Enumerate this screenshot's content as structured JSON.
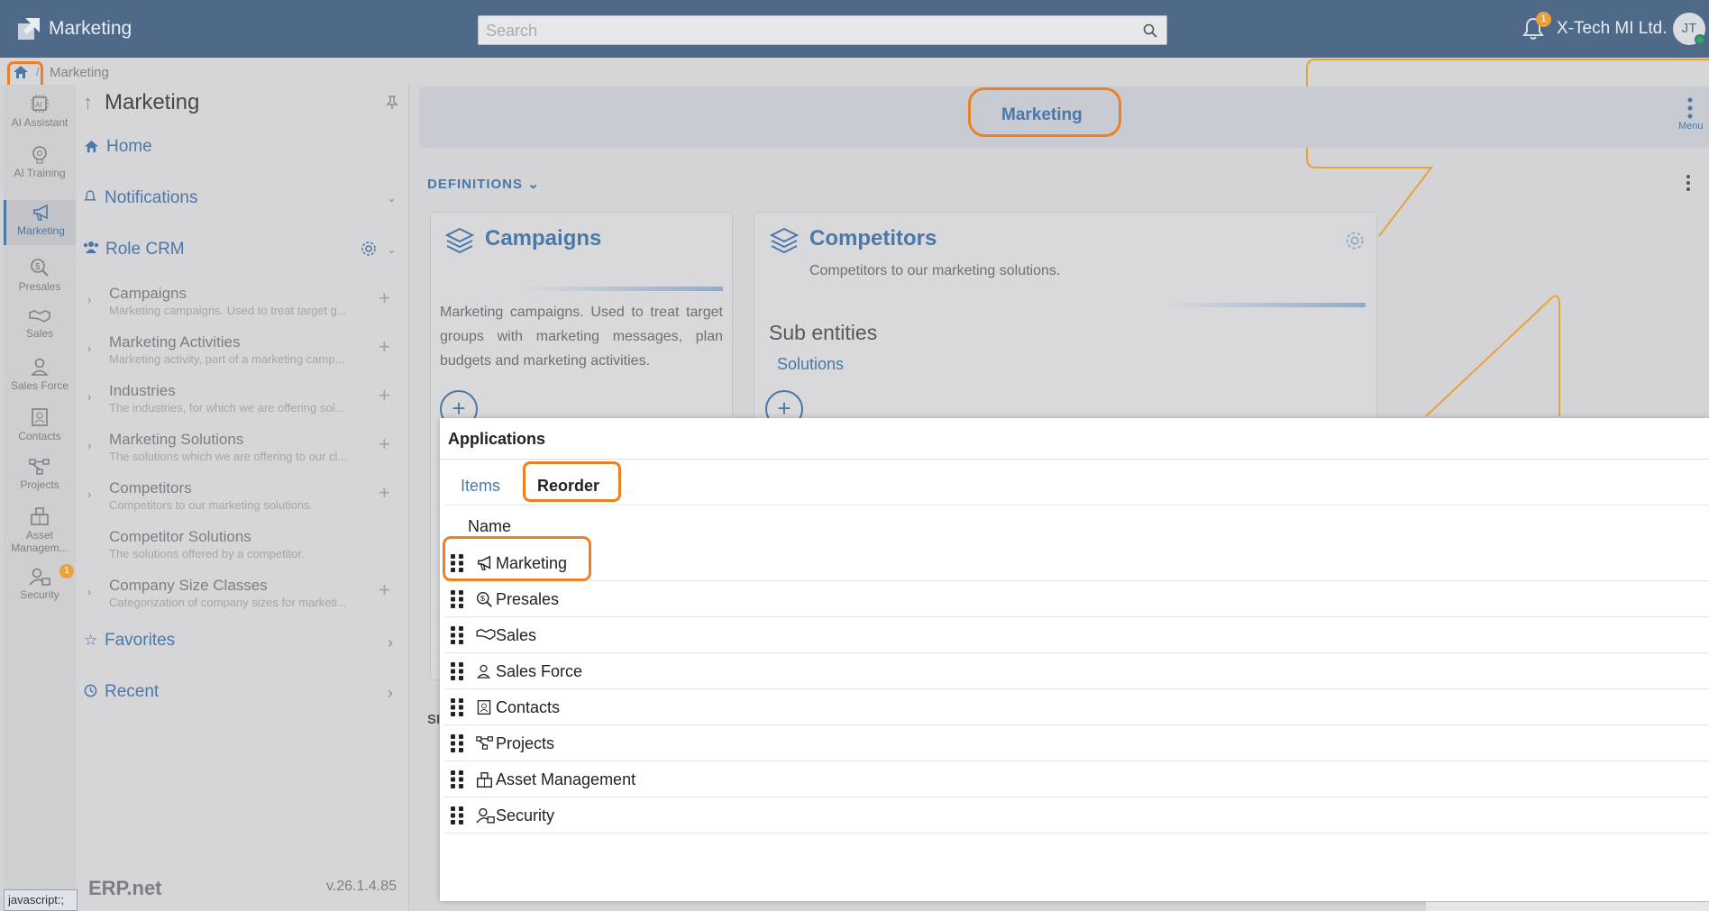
{
  "topbar": {
    "app_title": "Marketing",
    "search_placeholder": "Search",
    "notification_count": "1",
    "company": "X-Tech MI Ltd.",
    "user_initials": "JT"
  },
  "breadcrumb": {
    "separator": "/",
    "current": "Marketing"
  },
  "rail": {
    "items": [
      {
        "label": "AI Assistant",
        "icon": "ai-chip-icon"
      },
      {
        "label": "AI Training",
        "icon": "brain-icon"
      },
      {
        "label": "Marketing",
        "icon": "megaphone-icon"
      },
      {
        "label": "Presales",
        "icon": "magnify-dollar-icon"
      },
      {
        "label": "Sales",
        "icon": "handshake-icon"
      },
      {
        "label": "Sales Force",
        "icon": "people-icon"
      },
      {
        "label": "Contacts",
        "icon": "contact-card-icon"
      },
      {
        "label": "Projects",
        "icon": "flow-icon"
      },
      {
        "label": "Asset Managem...",
        "icon": "assets-icon"
      },
      {
        "label": "Security",
        "icon": "user-lock-icon"
      }
    ],
    "security_badge": "1"
  },
  "nav": {
    "title": "Marketing",
    "home": "Home",
    "notifications": "Notifications",
    "role": "Role CRM",
    "entries": [
      {
        "name": "Campaigns",
        "desc": "Marketing campaigns. Used to treat target g..."
      },
      {
        "name": "Marketing Activities",
        "desc": "Marketing activity, part of a marketing camp..."
      },
      {
        "name": "Industries",
        "desc": "The industries, for which we are offering sol..."
      },
      {
        "name": "Marketing Solutions",
        "desc": "The solutions which we are offering to our cl..."
      },
      {
        "name": "Competitors",
        "desc": "Competitors to our marketing solutions."
      },
      {
        "name": "Competitor Solutions",
        "desc": "The solutions offered by a competitor."
      },
      {
        "name": "Company Size Classes",
        "desc": "Categorization of company sizes for marketi..."
      }
    ],
    "favorites": "Favorites",
    "recent": "Recent",
    "logo": "ERP.net",
    "version": "v.26.1.4.85"
  },
  "status_bar": "javascript:;",
  "main": {
    "title": "Marketing",
    "menu_label": "Menu",
    "definitions_label": "DEFINITIONS",
    "section_cut": "SI",
    "campaigns": {
      "title": "Campaigns",
      "text": "Marketing campaigns. Used to treat target groups with marketing messages, plan budgets and marketing activities."
    },
    "competitors": {
      "title": "Competitors",
      "subtitle": "Competitors to our marketing solutions.",
      "sub_entities": "Sub entities",
      "link": "Solutions"
    }
  },
  "dialog": {
    "title": "Applications",
    "tabs": [
      "Items",
      "Reorder"
    ],
    "column": "Name",
    "rows": [
      {
        "label": "Marketing",
        "icon": "megaphone-icon"
      },
      {
        "label": "Presales",
        "icon": "magnify-dollar-icon"
      },
      {
        "label": "Sales",
        "icon": "handshake-icon"
      },
      {
        "label": "Sales Force",
        "icon": "people-icon"
      },
      {
        "label": "Contacts",
        "icon": "contact-card-icon"
      },
      {
        "label": "Projects",
        "icon": "flow-icon"
      },
      {
        "label": "Asset Management",
        "icon": "assets-icon"
      },
      {
        "label": "Security",
        "icon": "user-lock-icon"
      }
    ]
  },
  "colors": {
    "brand": "#4f6a88",
    "accent_link": "#4a78a8",
    "highlight": "#f07f22"
  }
}
